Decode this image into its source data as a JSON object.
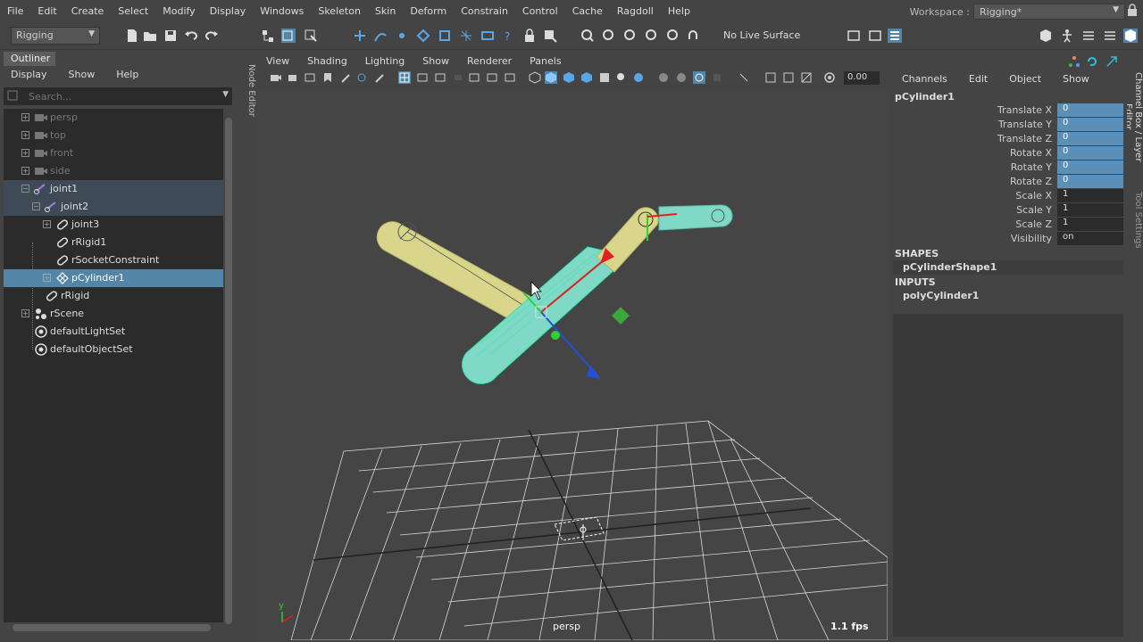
{
  "menubar": {
    "items": [
      "File",
      "Edit",
      "Create",
      "Select",
      "Modify",
      "Display",
      "Windows",
      "Skeleton",
      "Skin",
      "Deform",
      "Constrain",
      "Control",
      "Cache",
      "Ragdoll",
      "Help"
    ],
    "workspace_label": "Workspace :",
    "workspace_value": "Rigging*"
  },
  "statusline": {
    "menuset": "Rigging",
    "live_surface": "No Live Surface"
  },
  "outliner": {
    "tab": "Outliner",
    "menus": [
      "Display",
      "Show",
      "Help"
    ],
    "search_placeholder": "Search...",
    "rows": [
      {
        "label": "persp",
        "icon": "camera-icon"
      },
      {
        "label": "top",
        "icon": "camera-icon"
      },
      {
        "label": "front",
        "icon": "camera-icon"
      },
      {
        "label": "side",
        "icon": "camera-icon"
      },
      {
        "label": "joint1",
        "icon": "joint-icon"
      },
      {
        "label": "joint2",
        "icon": "joint-icon"
      },
      {
        "label": "joint3",
        "icon": "rigid-body-icon"
      },
      {
        "label": "rRigid1",
        "icon": "rigid-body-icon"
      },
      {
        "label": "rSocketConstraint",
        "icon": "constraint-icon"
      },
      {
        "label": "pCylinder1",
        "icon": "mesh-icon"
      },
      {
        "label": "rRigid",
        "icon": "rigid-body-icon"
      },
      {
        "label": "rScene",
        "icon": "scene-icon"
      },
      {
        "label": "defaultLightSet",
        "icon": "set-icon"
      },
      {
        "label": "defaultObjectSet",
        "icon": "set-icon"
      }
    ]
  },
  "side_tabs": {
    "node_editor": "Node Editor",
    "channel_box": "Channel Box / Layer Editor",
    "tool_settings": "Tool Settings"
  },
  "viewport": {
    "menus": [
      "View",
      "Shading",
      "Lighting",
      "Show",
      "Renderer",
      "Panels"
    ],
    "exposure_value": "0.00",
    "camera_name": "persp",
    "fps": "1.1 fps",
    "axis_y": "y"
  },
  "channel_box": {
    "menus": [
      "Channels",
      "Edit",
      "Object",
      "Show"
    ],
    "object_name": "pCylinder1",
    "attributes": [
      {
        "name": "Translate X",
        "value": "0",
        "keyed": true
      },
      {
        "name": "Translate Y",
        "value": "0",
        "keyed": true
      },
      {
        "name": "Translate Z",
        "value": "0",
        "keyed": true
      },
      {
        "name": "Rotate X",
        "value": "0",
        "keyed": true
      },
      {
        "name": "Rotate Y",
        "value": "0",
        "keyed": true
      },
      {
        "name": "Rotate Z",
        "value": "0",
        "keyed": true
      },
      {
        "name": "Scale X",
        "value": "1",
        "keyed": false
      },
      {
        "name": "Scale Y",
        "value": "1",
        "keyed": false
      },
      {
        "name": "Scale Z",
        "value": "1",
        "keyed": false
      },
      {
        "name": "Visibility",
        "value": "on",
        "keyed": false
      }
    ],
    "shapes_header": "SHAPES",
    "shape_node": "pCylinderShape1",
    "inputs_header": "INPUTS",
    "input_node": "polyCylinder1"
  },
  "colors": {
    "selection": "#5285a6",
    "keyed": "#5c8fb8",
    "bone_yellow": "#d9d68c",
    "mesh_cyan": "#7fd9c6"
  }
}
